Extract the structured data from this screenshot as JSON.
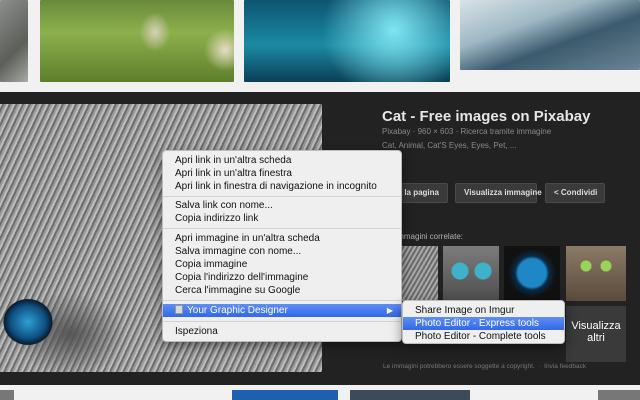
{
  "result": {
    "title": "Cat - Free images on Pixabay",
    "meta": "Pixabay · 960 × 603 · Ricerca tramite immagine",
    "tags": "Cat, Animal, Cat'S Eyes, Eyes, Pet, ...",
    "visit_label": "Visita la pagina",
    "view_image_label": "Visualizza immagine",
    "share_label": "Condividi",
    "share_icon": "share-icon",
    "related_label": "Immagini correlate:",
    "view_more_label": "Visualizza altri",
    "copyright_note": "Le immagini potrebbero essere soggette a copyright.",
    "feedback_label": "Invia feedback"
  },
  "context_menu": {
    "open_new_tab": "Apri link in un'altra scheda",
    "open_new_window": "Apri link in un'altra finestra",
    "open_incognito": "Apri link in finestra di navigazione in incognito",
    "save_link_as": "Salva link con nome...",
    "copy_link_address": "Copia indirizzo link",
    "open_image_new_tab": "Apri immagine in un'altra scheda",
    "save_image_as": "Salva immagine con nome...",
    "copy_image": "Copia immagine",
    "copy_image_address": "Copia l'indirizzo dell'immagine",
    "search_image_google": "Cerca l'immagine su Google",
    "extension_label": "Your Graphic Designer",
    "extension_icon": "extension-icon",
    "submenu_arrow": "▶",
    "inspect": "Ispeziona"
  },
  "submenu": {
    "share_imgur": "Share Image on Imgur",
    "editor_express": "Photo Editor - Express tools",
    "editor_complete": "Photo Editor - Complete tools"
  },
  "colors": {
    "menu_highlight": "#3a6fe8",
    "panel_background": "#222222"
  }
}
